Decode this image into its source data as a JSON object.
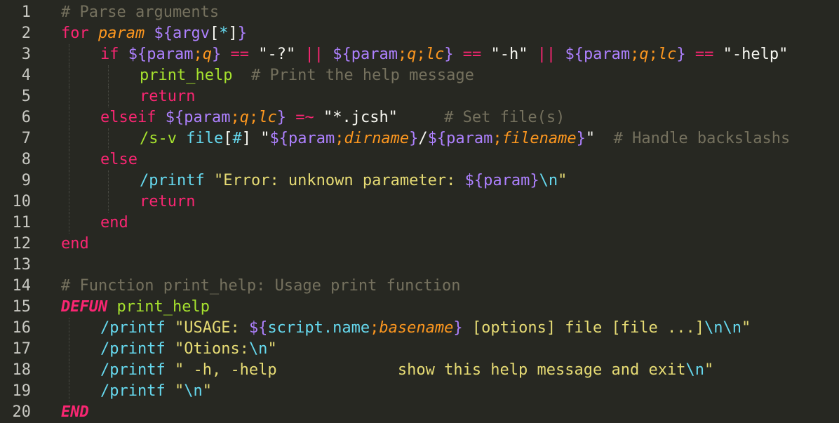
{
  "editor": {
    "theme": "Monokai",
    "background": "#272822",
    "colors": {
      "pl": "#f8f8f2",
      "kw": "#f92672",
      "cm": "#75715e",
      "st": "#e6db74",
      "vr": "#ae81ff",
      "sb": "#fd971f",
      "fn": "#a6e22e",
      "sy": "#66d9ef",
      "ln": "#c8c8c2"
    },
    "lines": [
      {
        "n": "1",
        "indent": 0,
        "tokens": [
          [
            "# Parse arguments",
            "cm"
          ]
        ]
      },
      {
        "n": "2",
        "indent": 0,
        "tokens": [
          [
            "for",
            "kw"
          ],
          [
            " ",
            "pl"
          ],
          [
            "param",
            "sb",
            "it"
          ],
          [
            " ",
            "pl"
          ],
          [
            "${",
            "vr"
          ],
          [
            "argv",
            "vr"
          ],
          [
            "[",
            "pl"
          ],
          [
            "*",
            "sy"
          ],
          [
            "]",
            "pl"
          ],
          [
            "}",
            "vr"
          ]
        ]
      },
      {
        "n": "3",
        "indent": 1,
        "tokens": [
          [
            "if",
            "kw"
          ],
          [
            " ",
            "pl"
          ],
          [
            "${",
            "vr"
          ],
          [
            "param",
            "vr"
          ],
          [
            ";",
            "sb"
          ],
          [
            "q",
            "sb",
            "it"
          ],
          [
            "}",
            "vr"
          ],
          [
            " ",
            "pl"
          ],
          [
            "==",
            "kw"
          ],
          [
            " ",
            "pl"
          ],
          [
            "\"-?\"",
            "pl"
          ],
          [
            " ",
            "pl"
          ],
          [
            "||",
            "kw"
          ],
          [
            " ",
            "pl"
          ],
          [
            "${",
            "vr"
          ],
          [
            "param",
            "vr"
          ],
          [
            ";",
            "sb"
          ],
          [
            "q",
            "sb",
            "it"
          ],
          [
            ";",
            "sb"
          ],
          [
            "lc",
            "sb",
            "it"
          ],
          [
            "}",
            "vr"
          ],
          [
            " ",
            "pl"
          ],
          [
            "==",
            "kw"
          ],
          [
            " ",
            "pl"
          ],
          [
            "\"-h\"",
            "pl"
          ],
          [
            " ",
            "pl"
          ],
          [
            "||",
            "kw"
          ],
          [
            " ",
            "pl"
          ],
          [
            "${",
            "vr"
          ],
          [
            "param",
            "vr"
          ],
          [
            ";",
            "sb"
          ],
          [
            "q",
            "sb",
            "it"
          ],
          [
            ";",
            "sb"
          ],
          [
            "lc",
            "sb",
            "it"
          ],
          [
            "}",
            "vr"
          ],
          [
            " ",
            "pl"
          ],
          [
            "==",
            "kw"
          ],
          [
            " ",
            "pl"
          ],
          [
            "\"-help\"",
            "pl"
          ]
        ]
      },
      {
        "n": "4",
        "indent": 2,
        "tokens": [
          [
            "print_help",
            "fn"
          ],
          [
            "  ",
            "pl"
          ],
          [
            "# Print the help message",
            "cm"
          ]
        ]
      },
      {
        "n": "5",
        "indent": 2,
        "tokens": [
          [
            "return",
            "kw"
          ]
        ]
      },
      {
        "n": "6",
        "indent": 1,
        "tokens": [
          [
            "elseif",
            "kw"
          ],
          [
            " ",
            "pl"
          ],
          [
            "${",
            "vr"
          ],
          [
            "param",
            "vr"
          ],
          [
            ";",
            "sb"
          ],
          [
            "q",
            "sb",
            "it"
          ],
          [
            ";",
            "sb"
          ],
          [
            "lc",
            "sb",
            "it"
          ],
          [
            "}",
            "vr"
          ],
          [
            " ",
            "pl"
          ],
          [
            "=~",
            "kw"
          ],
          [
            " ",
            "pl"
          ],
          [
            "\"*.jcsh\"",
            "pl"
          ],
          [
            "     ",
            "pl"
          ],
          [
            "# Set file(s)",
            "cm"
          ]
        ]
      },
      {
        "n": "7",
        "indent": 2,
        "tokens": [
          [
            "/s-v",
            "fn"
          ],
          [
            " ",
            "pl"
          ],
          [
            "file",
            "sy"
          ],
          [
            "[",
            "pl"
          ],
          [
            "#",
            "sy"
          ],
          [
            "]",
            "pl"
          ],
          [
            " ",
            "pl"
          ],
          [
            "\"",
            "pl"
          ],
          [
            "${",
            "vr"
          ],
          [
            "param",
            "vr"
          ],
          [
            ";",
            "sb"
          ],
          [
            "dirname",
            "sb",
            "it"
          ],
          [
            "}",
            "vr"
          ],
          [
            "/",
            "pl"
          ],
          [
            "${",
            "vr"
          ],
          [
            "param",
            "vr"
          ],
          [
            ";",
            "sb"
          ],
          [
            "filename",
            "sb",
            "it"
          ],
          [
            "}",
            "vr"
          ],
          [
            "\"",
            "pl"
          ],
          [
            "  ",
            "pl"
          ],
          [
            "# Handle backslashs",
            "cm"
          ]
        ]
      },
      {
        "n": "8",
        "indent": 1,
        "tokens": [
          [
            "else",
            "kw"
          ]
        ]
      },
      {
        "n": "9",
        "indent": 2,
        "tokens": [
          [
            "/printf",
            "sy"
          ],
          [
            " ",
            "pl"
          ],
          [
            "\"Error: unknown parameter: ",
            "st"
          ],
          [
            "${",
            "vr"
          ],
          [
            "param",
            "vr"
          ],
          [
            "}",
            "vr"
          ],
          [
            "\\n",
            "sy"
          ],
          [
            "\"",
            "st"
          ]
        ]
      },
      {
        "n": "10",
        "indent": 2,
        "tokens": [
          [
            "return",
            "kw"
          ]
        ]
      },
      {
        "n": "11",
        "indent": 1,
        "tokens": [
          [
            "end",
            "kw"
          ]
        ]
      },
      {
        "n": "12",
        "indent": 0,
        "tokens": [
          [
            "end",
            "kw"
          ]
        ]
      },
      {
        "n": "13",
        "indent": 0,
        "tokens": []
      },
      {
        "n": "14",
        "indent": 0,
        "tokens": [
          [
            "# Function print_help: Usage print function",
            "cm"
          ]
        ]
      },
      {
        "n": "15",
        "indent": 0,
        "tokens": [
          [
            "DEFUN",
            "kw",
            "bi"
          ],
          [
            " ",
            "pl"
          ],
          [
            "print_help",
            "fn"
          ]
        ]
      },
      {
        "n": "16",
        "indent": 1,
        "tokens": [
          [
            "/printf",
            "sy"
          ],
          [
            " ",
            "pl"
          ],
          [
            "\"USAGE: ",
            "st"
          ],
          [
            "${",
            "vr"
          ],
          [
            "script.name",
            "sy"
          ],
          [
            ";",
            "sb"
          ],
          [
            "basename",
            "sb",
            "it"
          ],
          [
            "}",
            "vr"
          ],
          [
            " [options] file [file ...]",
            "st"
          ],
          [
            "\\n\\n",
            "sy"
          ],
          [
            "\"",
            "st"
          ]
        ]
      },
      {
        "n": "17",
        "indent": 1,
        "tokens": [
          [
            "/printf",
            "sy"
          ],
          [
            " ",
            "pl"
          ],
          [
            "\"Otions:",
            "st"
          ],
          [
            "\\n",
            "sy"
          ],
          [
            "\"",
            "st"
          ]
        ]
      },
      {
        "n": "18",
        "indent": 1,
        "tokens": [
          [
            "/printf",
            "sy"
          ],
          [
            " ",
            "pl"
          ],
          [
            "\" -h, -help             show this help message and exit",
            "st"
          ],
          [
            "\\n",
            "sy"
          ],
          [
            "\"",
            "st"
          ]
        ]
      },
      {
        "n": "19",
        "indent": 1,
        "tokens": [
          [
            "/printf",
            "sy"
          ],
          [
            " ",
            "pl"
          ],
          [
            "\"",
            "st"
          ],
          [
            "\\n",
            "sy"
          ],
          [
            "\"",
            "st"
          ]
        ]
      },
      {
        "n": "20",
        "indent": 0,
        "tokens": [
          [
            "END",
            "kw",
            "bi"
          ]
        ]
      }
    ]
  }
}
